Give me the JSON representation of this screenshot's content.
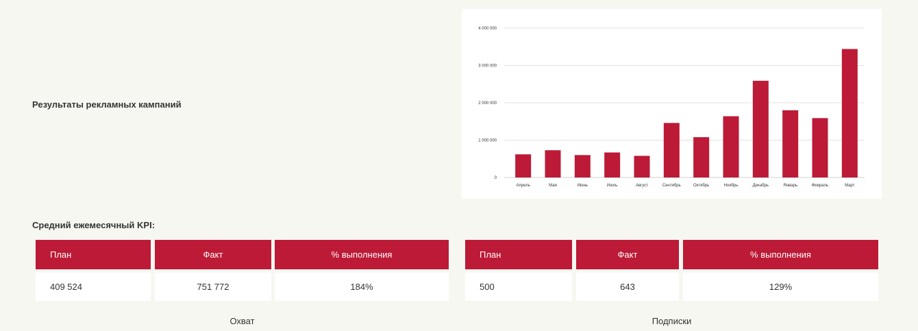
{
  "section": {
    "title": "Результаты рекламных кампаний"
  },
  "kpi": {
    "title": "Средний ежемесячный KPI:",
    "tables": [
      {
        "headers": [
          "План",
          "Факт",
          "% выполнения"
        ],
        "values": [
          "409 524",
          "751 772",
          "184%"
        ],
        "caption": "Охват"
      },
      {
        "headers": [
          "План",
          "Факт",
          "% выполнения"
        ],
        "values": [
          "500",
          "643",
          "129%"
        ],
        "caption": "Подписки"
      }
    ]
  },
  "colors": {
    "accent": "#bc1a36",
    "background": "#f7f7f2",
    "card": "#ffffff"
  },
  "chart_data": {
    "type": "bar",
    "categories": [
      "Апрель",
      "Мая",
      "Июнь",
      "Июль",
      "Август",
      "Сентябрь",
      "Октябрь",
      "Ноябрь",
      "Декабрь",
      "Январь",
      "Февраль",
      "Март"
    ],
    "values": [
      620000,
      730000,
      600000,
      670000,
      580000,
      1460000,
      1080000,
      1640000,
      2590000,
      1800000,
      1590000,
      3440000
    ],
    "yticks": [
      0,
      1000000,
      2000000,
      3000000,
      4000000
    ],
    "ytick_labels": [
      "0",
      "1 000 000",
      "2 000 000",
      "3 000 000",
      "4 000 000"
    ],
    "ylim": [
      0,
      4000000
    ],
    "grid": true,
    "legend": "none",
    "color": "#bc1a36"
  }
}
